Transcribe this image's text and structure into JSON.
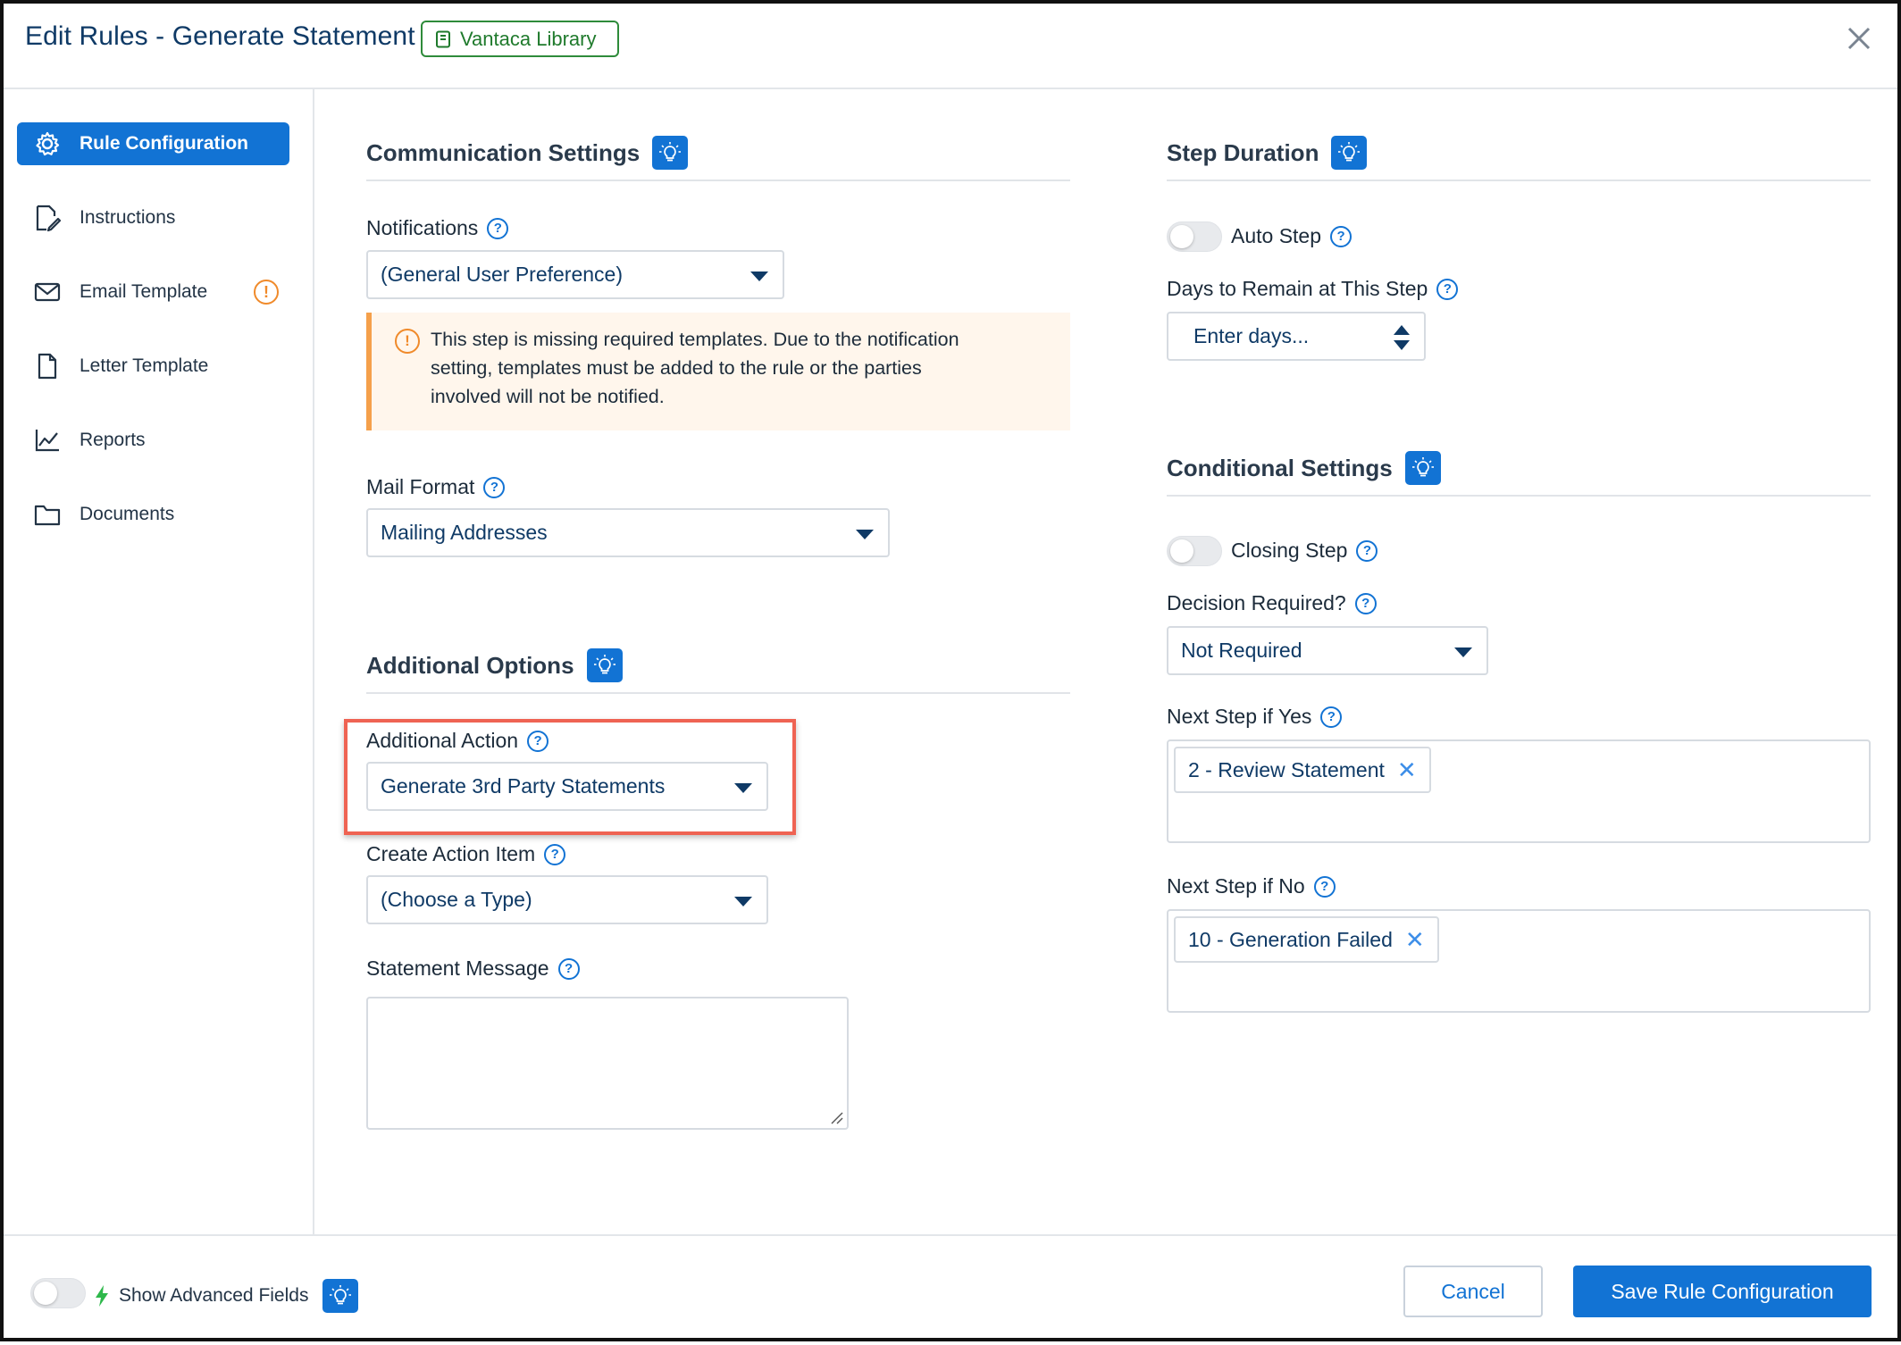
{
  "header": {
    "title": "Edit Rules - Generate Statement",
    "library_badge": "Vantaca Library"
  },
  "sidebar": {
    "items": [
      {
        "label": "Rule Configuration",
        "icon": "gear-icon",
        "active": true
      },
      {
        "label": "Instructions",
        "icon": "pencil-document-icon"
      },
      {
        "label": "Email Template",
        "icon": "envelope-icon",
        "warning": "!"
      },
      {
        "label": "Letter Template",
        "icon": "document-icon"
      },
      {
        "label": "Reports",
        "icon": "line-chart-icon"
      },
      {
        "label": "Documents",
        "icon": "folder-icon"
      }
    ]
  },
  "communication": {
    "heading": "Communication Settings",
    "notifications_label": "Notifications",
    "notifications_value": "(General User Preference)",
    "alert_line1": "This step is missing required templates. Due to the notification",
    "alert_line2": "setting, templates must be added to the rule or the parties",
    "alert_line3": "involved will not be notified.",
    "mail_format_label": "Mail Format",
    "mail_format_value": "Mailing Addresses"
  },
  "additional": {
    "heading": "Additional Options",
    "action_label": "Additional Action",
    "action_value": "Generate 3rd Party Statements",
    "action_item_label": "Create Action Item",
    "action_item_value": "(Choose a Type)",
    "statement_label": "Statement Message",
    "statement_value": ""
  },
  "duration": {
    "heading": "Step Duration",
    "auto_step_label": "Auto Step",
    "days_label": "Days to Remain at This Step",
    "days_placeholder": "Enter days..."
  },
  "conditional": {
    "heading": "Conditional Settings",
    "closing_label": "Closing Step",
    "decision_label": "Decision Required?",
    "decision_value": "Not Required",
    "yes_label": "Next Step if Yes",
    "yes_chip": "2 - Review Statement",
    "no_label": "Next Step if No",
    "no_chip": "10 - Generation Failed"
  },
  "footer": {
    "advanced_label": "Show Advanced Fields",
    "cancel_label": "Cancel",
    "save_label": "Save Rule Configuration"
  },
  "colors": {
    "accent": "#1273d4",
    "title": "#0f3a66",
    "library_green": "#1f7a2c",
    "warning_orange": "#f08a2a",
    "highlight_red": "#ef6353"
  }
}
